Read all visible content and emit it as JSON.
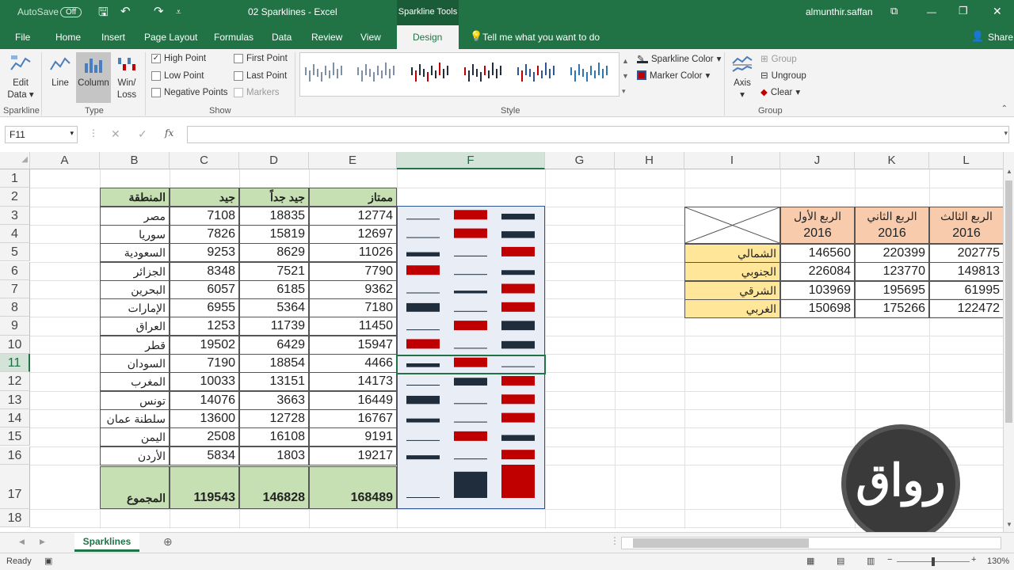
{
  "titlebar": {
    "autosave": "AutoSave",
    "autosave_state": "Off",
    "doc_title": "02 Sparklines  -  Excel",
    "context_header": "Sparkline Tools",
    "user": "almunthir.saffan"
  },
  "tabs": [
    "File",
    "Home",
    "Insert",
    "Page Layout",
    "Formulas",
    "Data",
    "Review",
    "View",
    "Design"
  ],
  "tell_me": "Tell me what you want to do",
  "share": "Share",
  "ribbon": {
    "edit_data": "Edit Data",
    "type_line": "Line",
    "type_column": "Column",
    "type_winloss": "Win/ Loss",
    "high_point": "High Point",
    "low_point": "Low Point",
    "negative_points": "Negative Points",
    "first_point": "First Point",
    "last_point": "Last Point",
    "markers": "Markers",
    "sparkline_color": "Sparkline Color",
    "marker_color": "Marker Color",
    "axis": "Axis",
    "group": "Group",
    "ungroup": "Ungroup",
    "clear": "Clear",
    "groups": {
      "sparkline": "Sparkline",
      "type": "Type",
      "show": "Show",
      "style": "Style",
      "group": "Group"
    }
  },
  "namebox": "F11",
  "columns": [
    "A",
    "B",
    "C",
    "D",
    "E",
    "F",
    "G",
    "H",
    "I",
    "J",
    "K",
    "L"
  ],
  "rows": [
    "1",
    "2",
    "3",
    "4",
    "5",
    "6",
    "7",
    "8",
    "9",
    "10",
    "11",
    "12",
    "13",
    "14",
    "15",
    "16",
    "17",
    "18"
  ],
  "table": {
    "headers": {
      "region": "المنطقة",
      "good": "جيد",
      "very_good": "جيد جداً",
      "excellent": "ممتاز"
    },
    "rows": [
      {
        "region": "مصر",
        "c": "7108",
        "d": "18835",
        "e": "12774"
      },
      {
        "region": "سوريا",
        "c": "7826",
        "d": "15819",
        "e": "12697"
      },
      {
        "region": "السعودية",
        "c": "9253",
        "d": "8629",
        "e": "11026"
      },
      {
        "region": "الجزائر",
        "c": "8348",
        "d": "7521",
        "e": "7790"
      },
      {
        "region": "البحرين",
        "c": "6057",
        "d": "6185",
        "e": "9362"
      },
      {
        "region": "الإمارات",
        "c": "6955",
        "d": "5364",
        "e": "7180"
      },
      {
        "region": "العراق",
        "c": "1253",
        "d": "11739",
        "e": "11450"
      },
      {
        "region": "قطر",
        "c": "19502",
        "d": "6429",
        "e": "15947"
      },
      {
        "region": "السودان",
        "c": "7190",
        "d": "18854",
        "e": "4466"
      },
      {
        "region": "المغرب",
        "c": "10033",
        "d": "13151",
        "e": "14173"
      },
      {
        "region": "تونس",
        "c": "14076",
        "d": "3663",
        "e": "16449"
      },
      {
        "region": "سلطنة عمان",
        "c": "13600",
        "d": "12728",
        "e": "16767"
      },
      {
        "region": "اليمن",
        "c": "2508",
        "d": "16108",
        "e": "9191"
      },
      {
        "region": "الأردن",
        "c": "5834",
        "d": "1803",
        "e": "19217"
      }
    ],
    "total": {
      "label": "المجموع",
      "c": "119543",
      "d": "146828",
      "e": "168489"
    }
  },
  "side_table": {
    "headers": [
      {
        "quarter": "الربع الأول",
        "year": "2016"
      },
      {
        "quarter": "الربع الثاني",
        "year": "2016"
      },
      {
        "quarter": "الربع الثالث",
        "year": "2016"
      }
    ],
    "rows": [
      {
        "label": "الشمالي",
        "j": "146560",
        "k": "220399",
        "l": "202775"
      },
      {
        "label": "الجنوبي",
        "j": "226084",
        "k": "123770",
        "l": "149813"
      },
      {
        "label": "الشرقي",
        "j": "103969",
        "k": "195695",
        "l": "61995"
      },
      {
        "label": "الغربي",
        "j": "150698",
        "k": "175266",
        "l": "122472"
      }
    ]
  },
  "sheet_tab": "Sparklines",
  "status": {
    "ready": "Ready",
    "zoom": "130%"
  },
  "logo_text": "رواق",
  "colors": {
    "accent": "#217346",
    "high": "#c00000",
    "bar": "#1f2d3d",
    "header_green": "#c6e0b4",
    "orange": "#f8cbad",
    "yellow": "#ffe699"
  }
}
